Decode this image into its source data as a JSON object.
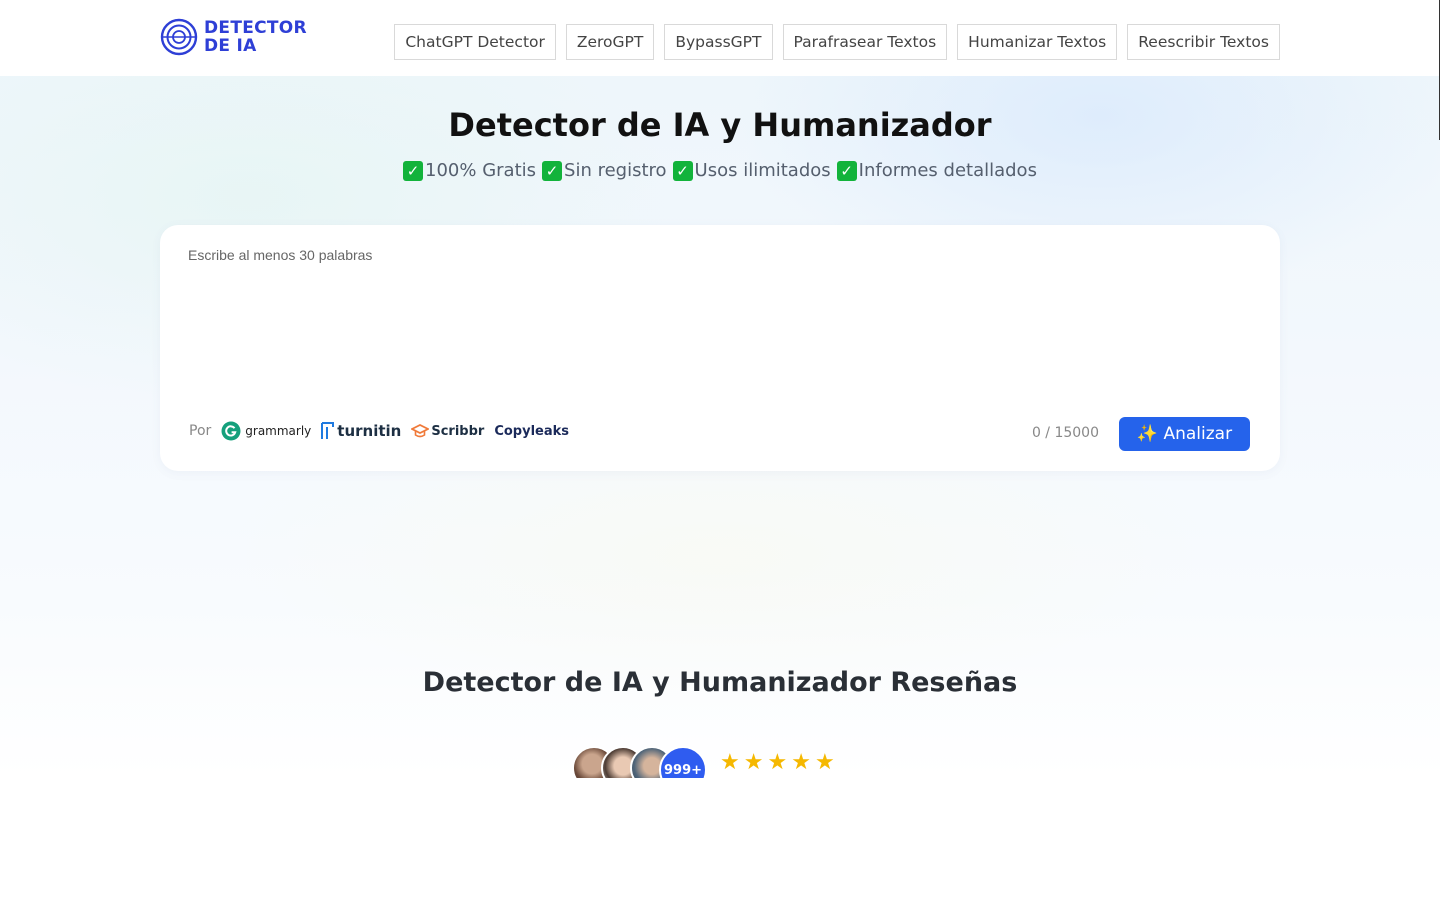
{
  "header": {
    "logo": {
      "line1": "DETECTOR",
      "line2": "DE IA",
      "icon": "concentric-circles-logo-icon"
    },
    "nav": [
      {
        "label": "ChatGPT Detector"
      },
      {
        "label": "ZeroGPT"
      },
      {
        "label": "BypassGPT"
      },
      {
        "label": "Parafrasear Textos"
      },
      {
        "label": "Humanizar Textos"
      },
      {
        "label": "Reescribir Textos"
      }
    ]
  },
  "hero": {
    "title": "Detector de IA y Humanizador",
    "features": [
      {
        "icon": "check-mark-icon",
        "label": "100% Gratis"
      },
      {
        "icon": "check-mark-icon",
        "label": "Sin registro"
      },
      {
        "icon": "check-mark-icon",
        "label": "Usos ilimitados"
      },
      {
        "icon": "check-mark-icon",
        "label": "Informes detallados"
      }
    ]
  },
  "editor": {
    "placeholder": "Escribe al menos 30 palabras",
    "value": "",
    "by_label": "Por",
    "brands": [
      {
        "name": "grammarly",
        "icon": "grammarly-logo-icon"
      },
      {
        "name": "turnitin",
        "icon": "turnitin-logo-icon"
      },
      {
        "name": "Scribbr",
        "icon": "scribbr-logo-icon"
      },
      {
        "name": "Copyleaks",
        "icon": "copyleaks-logo-icon"
      }
    ],
    "counter": "0 / 15000",
    "analyze_button": "✨ Analizar"
  },
  "reviews": {
    "title": "Detector de IA y Humanizador Reseñas",
    "more_count": "999+",
    "stars": 5
  },
  "colors": {
    "brand": "#2e3fd6",
    "accent": "#2563eb",
    "check": "#12b33b",
    "star": "#f5b800"
  }
}
